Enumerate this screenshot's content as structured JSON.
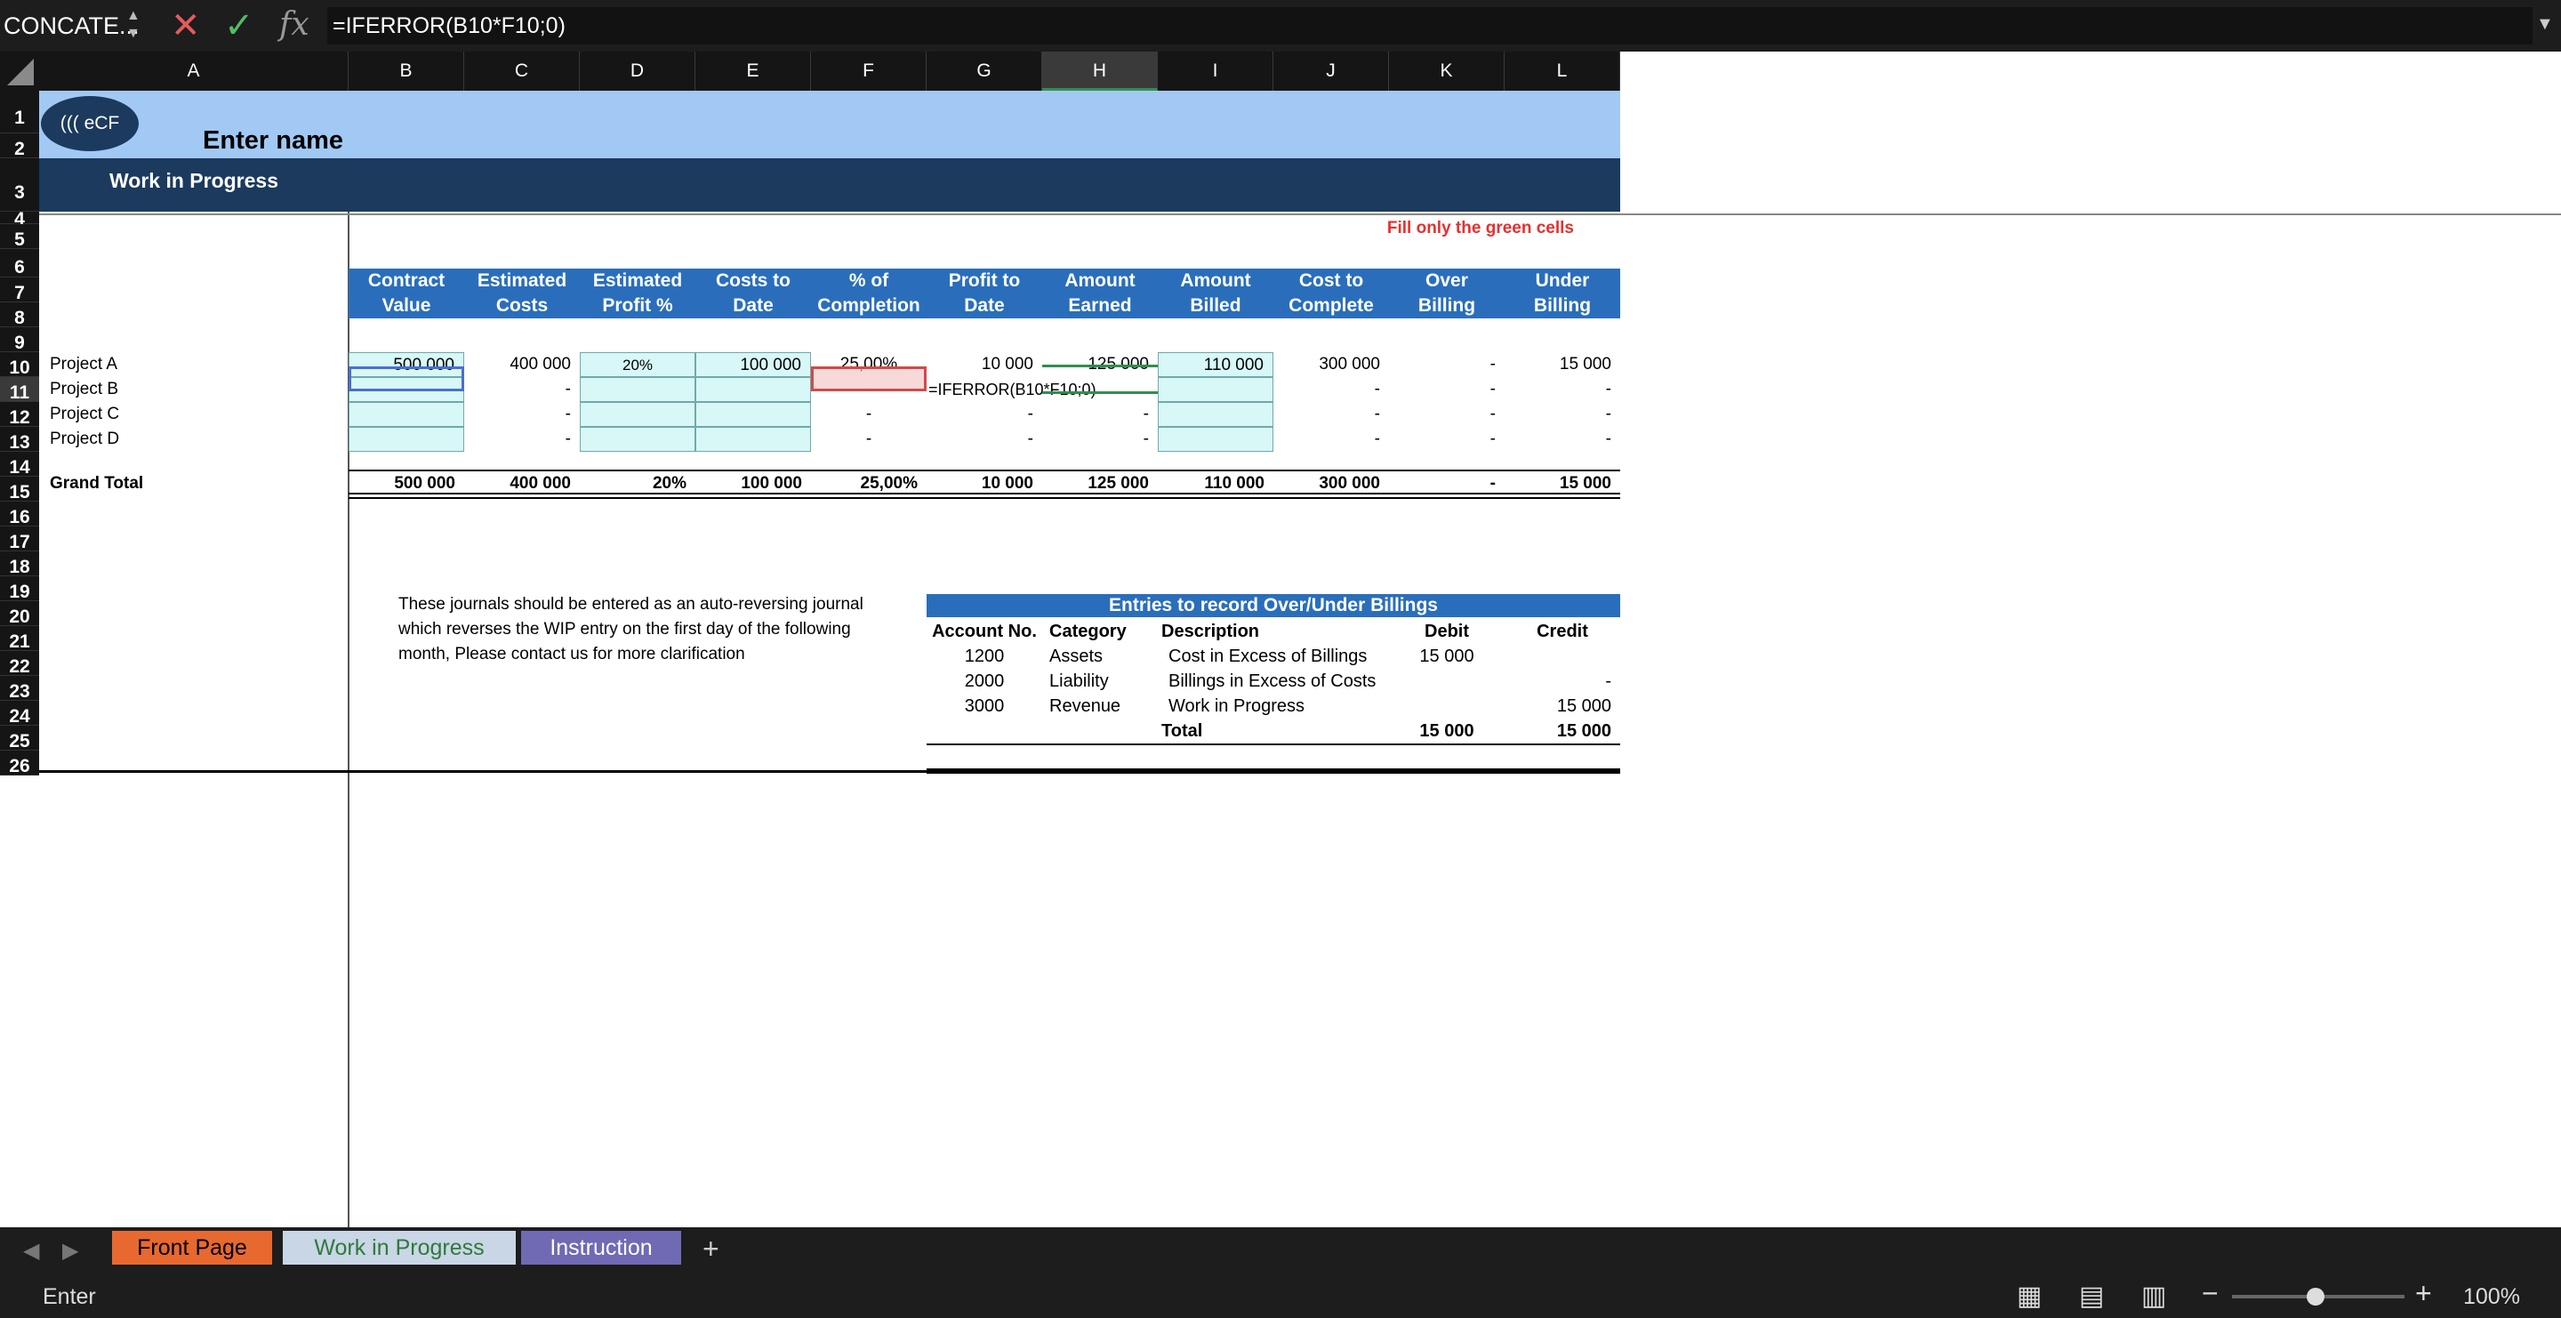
{
  "formula_bar": {
    "name_box": "CONCATE...",
    "formula": "=IFERROR(B10*F10;0)"
  },
  "columns": [
    "A",
    "B",
    "C",
    "D",
    "E",
    "F",
    "G",
    "H",
    "I",
    "J",
    "K",
    "L"
  ],
  "rows": [
    "1",
    "2",
    "3",
    "4",
    "5",
    "6",
    "7",
    "8",
    "9",
    "10",
    "11",
    "12",
    "13",
    "14",
    "15",
    "16",
    "17",
    "18",
    "19",
    "20",
    "21",
    "22",
    "23",
    "24",
    "25",
    "26"
  ],
  "header": {
    "logo_text": "((( eCF",
    "company_name": "Enter name",
    "sheet_title": "Work in Progress",
    "note": "Fill only the green cells"
  },
  "table": {
    "headers": [
      [
        "Contract",
        "Value"
      ],
      [
        "Estimated",
        "Costs"
      ],
      [
        "Estimated",
        "Profit %"
      ],
      [
        "Costs to",
        "Date"
      ],
      [
        "% of",
        "Completion"
      ],
      [
        "Profit to",
        "Date"
      ],
      [
        "Amount",
        "Earned"
      ],
      [
        "Amount",
        "Billed"
      ],
      [
        "Cost to",
        "Complete"
      ],
      [
        "Over",
        "Billing"
      ],
      [
        "Under",
        "Billing"
      ]
    ],
    "projects": [
      {
        "name": "Project A",
        "values": [
          "500 000",
          "400 000",
          "20%",
          "100 000",
          "25,00%",
          "10 000",
          "125 000",
          "110 000",
          "300 000",
          "-",
          "15 000"
        ]
      },
      {
        "name": "Project B",
        "values": [
          "",
          "-",
          "",
          "",
          "-",
          "=IFERROR(B10*F10;0)",
          "",
          "",
          "-",
          "-",
          "-"
        ]
      },
      {
        "name": "Project C",
        "values": [
          "",
          "-",
          "",
          "",
          "-",
          "-",
          "-",
          "",
          "-",
          "-",
          "-"
        ]
      },
      {
        "name": "Project D",
        "values": [
          "",
          "-",
          "",
          "",
          "-",
          "-",
          "-",
          "",
          "-",
          "-",
          "-"
        ]
      }
    ],
    "grand_total": {
      "label": "Grand Total",
      "values": [
        "500 000",
        "400 000",
        "20%",
        "100 000",
        "25,00%",
        "10 000",
        "125 000",
        "110 000",
        "300 000",
        "-",
        "15 000"
      ]
    }
  },
  "journal_note": [
    "These journals should be entered as an auto-reversing journal",
    "which reverses the WIP entry on the first day of the following",
    "month, Please contact us for more clarification"
  ],
  "entries": {
    "title": "Entries to record Over/Under Billings",
    "headers": [
      "Account No.",
      "Category",
      "Description",
      "Debit",
      "Credit"
    ],
    "rows": [
      [
        "1200",
        "Assets",
        "Cost in Excess of Billings",
        "15 000",
        ""
      ],
      [
        "2000",
        "Liability",
        "Billings in Excess of Costs",
        "",
        "-"
      ],
      [
        "3000",
        "Revenue",
        "Work in Progress",
        "",
        "15 000"
      ]
    ],
    "total": {
      "label": "Total",
      "debit": "15 000",
      "credit": "15 000"
    }
  },
  "tabs": [
    {
      "label": "Front Page",
      "color": "#e8692f"
    },
    {
      "label": "Work in Progress",
      "color": "#c9d6e6"
    },
    {
      "label": "Instruction",
      "color": "#6f6ab3"
    }
  ],
  "add_tab": "+",
  "status": {
    "mode": "Enter",
    "zoom": "100%"
  }
}
